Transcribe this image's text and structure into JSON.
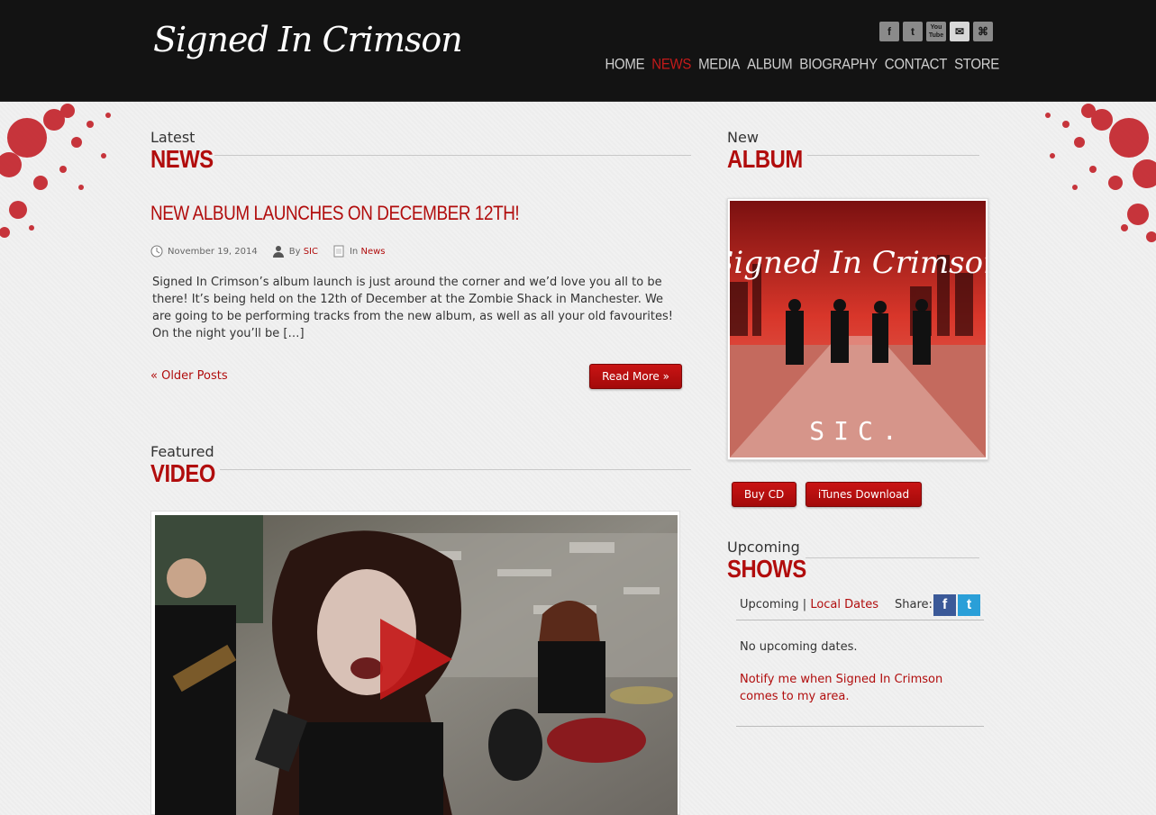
{
  "header": {
    "logo_text": "Signed In Crimson",
    "social": [
      {
        "icon": "facebook-icon",
        "glyph": "f"
      },
      {
        "icon": "twitter-icon",
        "glyph": "t"
      },
      {
        "icon": "youtube-icon",
        "glyph": "You Tube"
      },
      {
        "icon": "mail-icon",
        "glyph": "✉"
      },
      {
        "icon": "rss-icon",
        "glyph": "⌘"
      }
    ],
    "nav": [
      {
        "label": "HOME",
        "active": false
      },
      {
        "label": "NEWS",
        "active": true
      },
      {
        "label": "MEDIA",
        "active": false
      },
      {
        "label": "ALBUM",
        "active": false
      },
      {
        "label": "BIOGRAPHY",
        "active": false
      },
      {
        "label": "CONTACT",
        "active": false
      },
      {
        "label": "STORE",
        "active": false
      }
    ]
  },
  "news": {
    "kicker": "Latest",
    "heading": "NEWS",
    "post": {
      "title": "NEW ALBUM LAUNCHES ON DECEMBER 12TH!",
      "date": "November 19, 2014",
      "by_prefix": "By",
      "author": "SIC",
      "in_prefix": "In",
      "category": "News",
      "excerpt": "Signed In Crimson’s album launch is just around the corner and we’d love you all to be there! It’s being held on the 12th of December at the Zombie Shack in Manchester. We are going to be performing tracks from the new album, as well as all your old favourites! On the night you’ll be […]",
      "read_more": "Read More »"
    },
    "older_posts": "« Older Posts"
  },
  "video": {
    "kicker": "Featured",
    "heading": "VIDEO"
  },
  "album": {
    "kicker": "New",
    "heading": "ALBUM",
    "cover_title": "Signed In Crimson",
    "cover_subtitle": "SIC.",
    "buy_cd": "Buy CD",
    "itunes": "iTunes Download"
  },
  "shows": {
    "kicker": "Upcoming",
    "heading": "SHOWS",
    "tab_upcoming": "Upcoming",
    "separator": "|",
    "tab_local": "Local Dates",
    "share_label": "Share:",
    "fb_glyph": "f",
    "tw_glyph": "t",
    "no_dates": "No upcoming dates.",
    "notify": "Notify me when Signed In Crimson comes to my area."
  },
  "colors": {
    "accent": "#b10d0d",
    "header_bg": "#131313",
    "page_bg": "#f1f1f1"
  }
}
